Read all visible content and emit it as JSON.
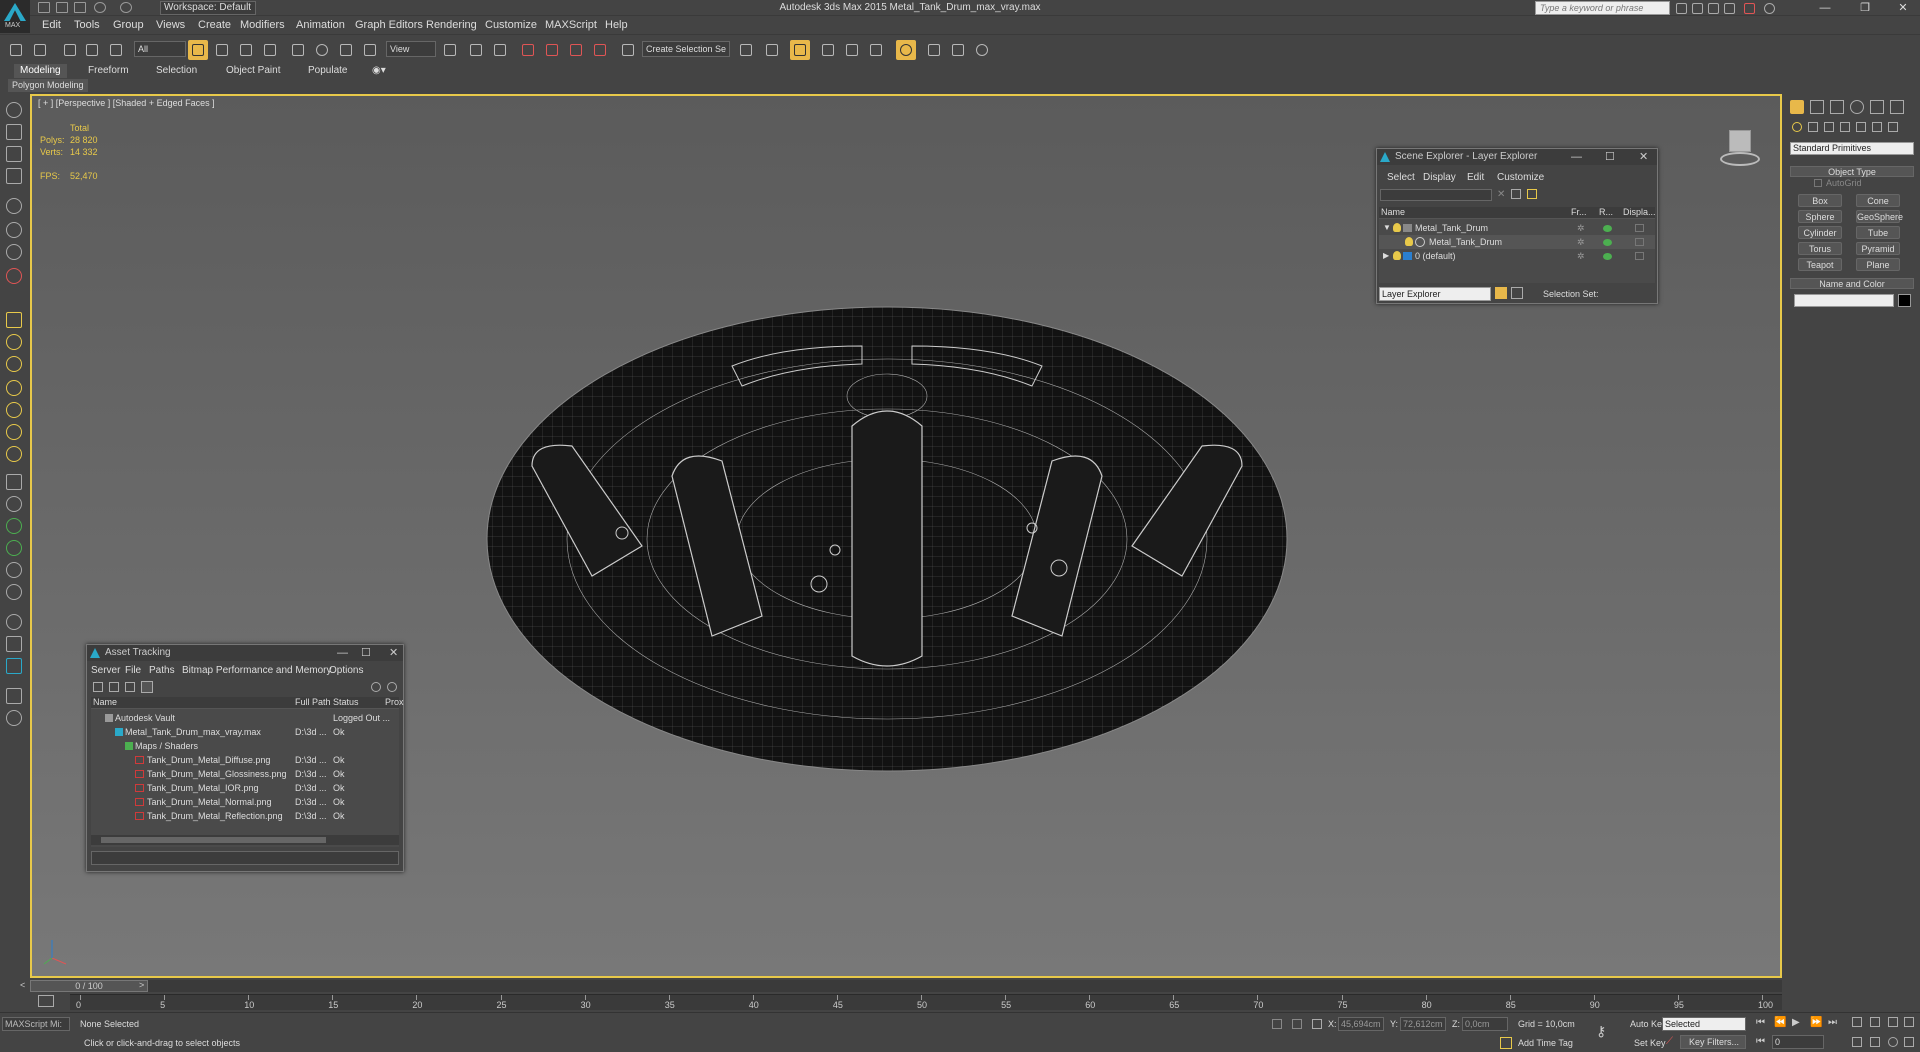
{
  "app": {
    "title": "Autodesk 3ds Max  2015     Metal_Tank_Drum_max_vray.max",
    "logo_label": "MAX"
  },
  "workspace": "Workspace: Default",
  "search_placeholder": "Type a keyword or phrase",
  "menu": [
    "Edit",
    "Tools",
    "Group",
    "Views",
    "Create",
    "Modifiers",
    "Animation",
    "Graph Editors",
    "Rendering",
    "Customize",
    "MAXScript",
    "Help"
  ],
  "toolbar": {
    "filter": "All",
    "ref_coord": "View",
    "selection_set": "Create Selection Se"
  },
  "ribbon": {
    "tabs": [
      "Modeling",
      "Freeform",
      "Selection",
      "Object Paint",
      "Populate"
    ],
    "sub": "Polygon Modeling"
  },
  "viewport": {
    "label": "[ + ] [Perspective ] [Shaded + Edged Faces ]",
    "stats": {
      "total": "Total",
      "polys_label": "Polys:",
      "polys": "28 820",
      "verts_label": "Verts:",
      "verts": "14 332",
      "fps_label": "FPS:",
      "fps": "52,470"
    }
  },
  "scene_explorer": {
    "title": "Scene Explorer - Layer Explorer",
    "menu": [
      "Select",
      "Display",
      "Edit",
      "Customize"
    ],
    "columns": [
      "Name",
      "Fr...",
      "R...",
      "Displa..."
    ],
    "rows": [
      "Metal_Tank_Drum",
      "Metal_Tank_Drum",
      "0 (default)"
    ],
    "footer": {
      "dropdown": "Layer Explorer",
      "selection_set": "Selection Set:"
    }
  },
  "asset_tracking": {
    "title": "Asset Tracking",
    "menu": [
      "Server",
      "File",
      "Paths",
      "Bitmap Performance and Memory",
      "Options"
    ],
    "columns": [
      "Name",
      "Full Path",
      "Status",
      "Prox"
    ],
    "rows": [
      {
        "name": "Autodesk Vault",
        "path": "",
        "status": "Logged Out ..."
      },
      {
        "name": "Metal_Tank_Drum_max_vray.max",
        "path": "D:\\3d ...",
        "status": "Ok"
      },
      {
        "name": "Maps / Shaders",
        "path": "",
        "status": ""
      },
      {
        "name": "Tank_Drum_Metal_Diffuse.png",
        "path": "D:\\3d ...",
        "status": "Ok"
      },
      {
        "name": "Tank_Drum_Metal_Glossiness.png",
        "path": "D:\\3d ...",
        "status": "Ok"
      },
      {
        "name": "Tank_Drum_Metal_IOR.png",
        "path": "D:\\3d ...",
        "status": "Ok"
      },
      {
        "name": "Tank_Drum_Metal_Normal.png",
        "path": "D:\\3d ...",
        "status": "Ok"
      },
      {
        "name": "Tank_Drum_Metal_Reflection.png",
        "path": "D:\\3d ...",
        "status": "Ok"
      }
    ]
  },
  "command_panel": {
    "category": "Standard Primitives",
    "object_type": "Object Type",
    "autogrid": "AutoGrid",
    "buttons": [
      "Box",
      "Cone",
      "Sphere",
      "GeoSphere",
      "Cylinder",
      "Tube",
      "Torus",
      "Pyramid",
      "Teapot",
      "Plane"
    ],
    "name_color": "Name and Color"
  },
  "timeline": {
    "slider": "0 / 100",
    "ticks": [
      "0",
      "5",
      "10",
      "15",
      "20",
      "25",
      "30",
      "35",
      "40",
      "45",
      "50",
      "55",
      "60",
      "65",
      "70",
      "75",
      "80",
      "85",
      "90",
      "95",
      "100"
    ]
  },
  "status": {
    "selection": "None Selected",
    "prompt": "Click or click-and-drag to select objects",
    "maxscript": "MAXScript Mi:",
    "x_label": "X:",
    "x": "45,694cm",
    "y_label": "Y:",
    "y": "72,612cm",
    "z_label": "Z:",
    "z": "0,0cm",
    "grid": "Grid = 10,0cm",
    "add_time_tag": "Add Time Tag",
    "auto_key": "Auto Key",
    "set_key": "Set Key",
    "key_mode": "Selected",
    "key_filters": "Key Filters...",
    "frame": "0"
  }
}
